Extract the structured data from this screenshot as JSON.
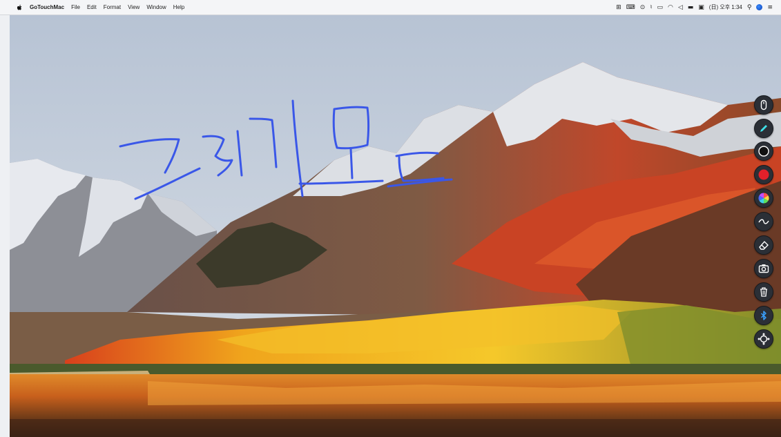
{
  "menubar": {
    "apple_icon": "apple-icon",
    "app_name": "GoTouchMac",
    "menus": [
      "File",
      "Edit",
      "Format",
      "View",
      "Window",
      "Help"
    ],
    "clock": "(日) 오후 1:34"
  },
  "desktop": {
    "handwriting": "그리기 모드",
    "handwriting_color": "#3a57e8"
  },
  "toolbar": {
    "tools": [
      "mouse-mode-icon",
      "pen-icon",
      "black-color-icon",
      "red-color-icon",
      "color-wheel-icon",
      "line-style-icon",
      "eraser-icon",
      "screenshot-icon",
      "trash-icon",
      "bluetooth-icon",
      "move-icon"
    ],
    "colors": {
      "black": "#111111",
      "red": "#e3202a",
      "pen": "#3fe0e8",
      "bluetooth": "#3aa0ff"
    }
  }
}
